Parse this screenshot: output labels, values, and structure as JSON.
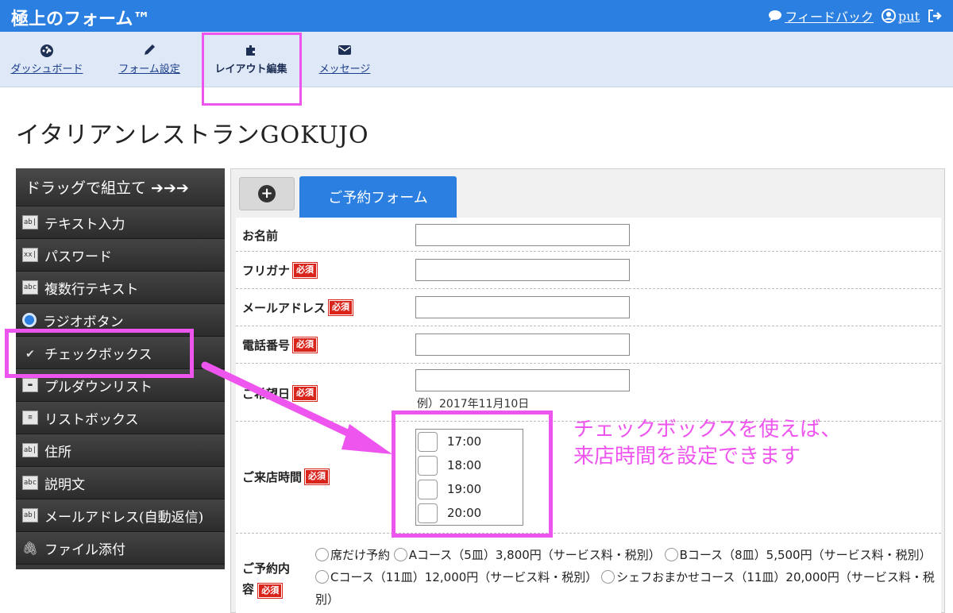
{
  "app": {
    "title": "極上のフォーム™",
    "feedback_label": "フィードバック",
    "user_label": "put"
  },
  "nav": {
    "items": [
      {
        "label": "ダッシュボード",
        "icon": "dashboard-icon"
      },
      {
        "label": "フォーム設定",
        "icon": "pencil-icon"
      },
      {
        "label": "レイアウト編集",
        "icon": "puzzle-icon"
      },
      {
        "label": "メッセージ",
        "icon": "envelope-icon"
      }
    ],
    "active": "レイアウト編集"
  },
  "page": {
    "title": "イタリアンレストランGOKUJO"
  },
  "palette": {
    "header": "ドラッグで組立て ➔➔➔",
    "items": [
      {
        "label": "テキスト入力",
        "icon": "ab|"
      },
      {
        "label": "パスワード",
        "icon": "xx|"
      },
      {
        "label": "複数行テキスト",
        "icon": "abc"
      },
      {
        "label": "ラジオボタン",
        "icon": "radio-icon"
      },
      {
        "label": "チェックボックス",
        "icon": "check-icon"
      },
      {
        "label": "プルダウンリスト",
        "icon": "dropdown-icon"
      },
      {
        "label": "リストボックス",
        "icon": "listbox-icon"
      },
      {
        "label": "住所",
        "icon": "ab|"
      },
      {
        "label": "説明文",
        "icon": "abc"
      },
      {
        "label": "メールアドレス(自動返信)",
        "icon": "ab|"
      },
      {
        "label": "ファイル添付",
        "icon": "paperclip-icon"
      }
    ]
  },
  "form": {
    "add_tab_icon": "plus-circle-icon",
    "tab_label": "ご予約フォーム",
    "required_label": "必須",
    "fields": {
      "name": "お名前",
      "kana": "フリガナ",
      "email": "メールアドレス",
      "phone": "電話番号",
      "date": "ご希望日",
      "date_hint": "例）2017年11月10日",
      "time": "ご来店時間",
      "course_1": "ご予約内",
      "course_2": "容"
    },
    "times": [
      "17:00",
      "18:00",
      "19:00",
      "20:00"
    ],
    "courses": [
      "席だけ予約",
      "Aコース（5皿）3,800円（サービス料・税別）",
      "Bコース（8皿）5,500円（サービス料・税別）",
      "Cコース（11皿）12,000円（サービス料・税別）",
      "シェフおまかせコース（11皿）20,000円（サービス料・税別）"
    ]
  },
  "annotation": {
    "line1": "チェックボックスを使えば、",
    "line2": "来店時間を設定できます",
    "color": "#ee55ee"
  },
  "colors": {
    "brand": "#2a7fe0",
    "required": "#d9241c",
    "palette_bg": "#3a3a3a"
  }
}
